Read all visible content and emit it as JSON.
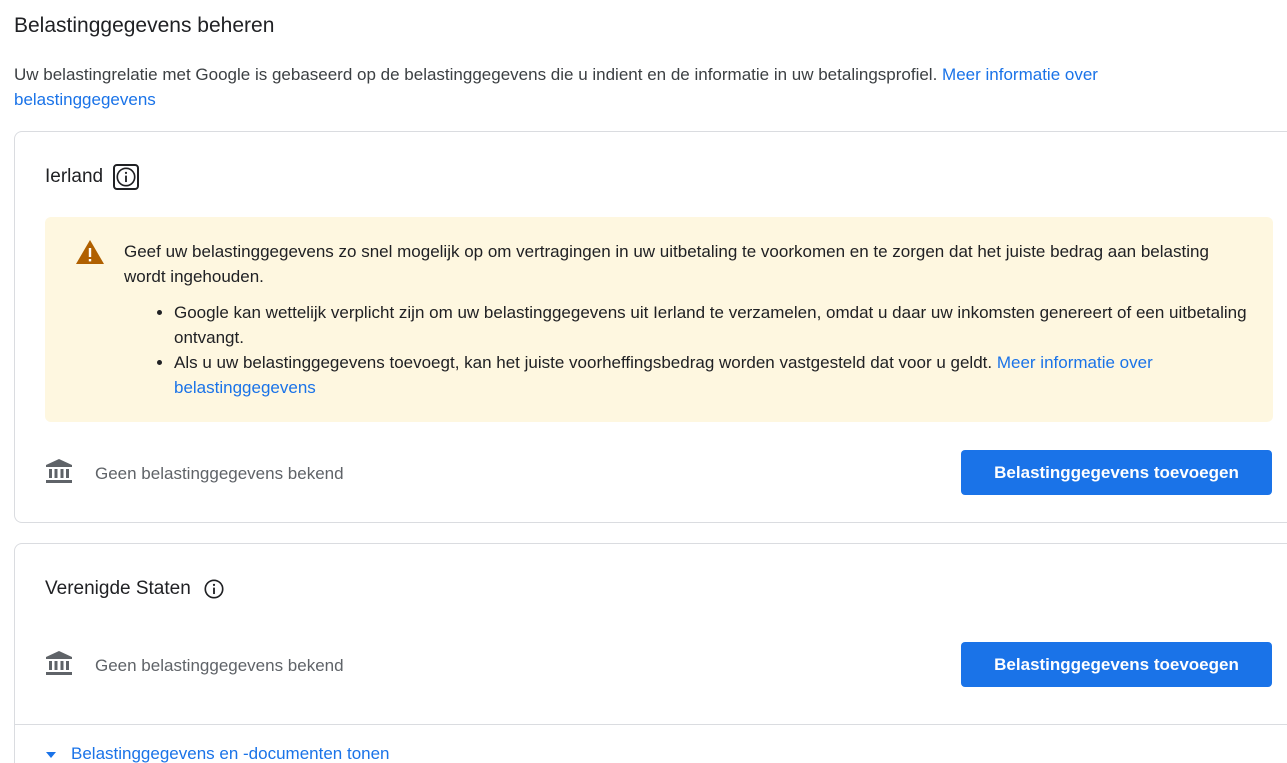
{
  "page": {
    "title": "Belastinggegevens beheren",
    "intro_text": "Uw belastingrelatie met Google is gebaseerd op de belastinggegevens die u indient en de informatie in uw betalingsprofiel.",
    "intro_link": "Meer informatie over belastinggegevens"
  },
  "ireland": {
    "name": "Ierland",
    "info_icon": "info-icon",
    "warning": {
      "icon": "warning-icon",
      "text": "Geef uw belastinggegevens zo snel mogelijk op om vertragingen in uw uitbetaling te voorkomen en te zorgen dat het juiste bedrag aan belasting wordt ingehouden.",
      "bullet_1": "Google kan wettelijk verplicht zijn om uw belastinggegevens uit Ierland te verzamelen, omdat u daar uw inkomsten genereert of een uitbetaling ontvangt.",
      "bullet_2_text": "Als u uw belastinggegevens toevoegt, kan het juiste voorheffingsbedrag worden vastgesteld dat voor u geldt.",
      "bullet_2_link": "Meer informatie over belastinggegevens"
    },
    "status_icon": "bank-icon",
    "status": "Geen belastinggegevens bekend",
    "button": "Belastinggegevens toevoegen"
  },
  "us": {
    "name": "Verenigde Staten",
    "info_icon": "info-icon",
    "status_icon": "bank-icon",
    "status": "Geen belastinggegevens bekend",
    "button": "Belastinggegevens toevoegen",
    "expander": "Belastinggegevens en -documenten tonen",
    "expander_icon": "caret-down-icon"
  },
  "colors": {
    "primary": "#1a73e8",
    "warning_bg": "#fef7e0",
    "warning_icon": "#b06000",
    "text": "#202124",
    "muted": "#5f6368",
    "border": "#dadce0"
  }
}
